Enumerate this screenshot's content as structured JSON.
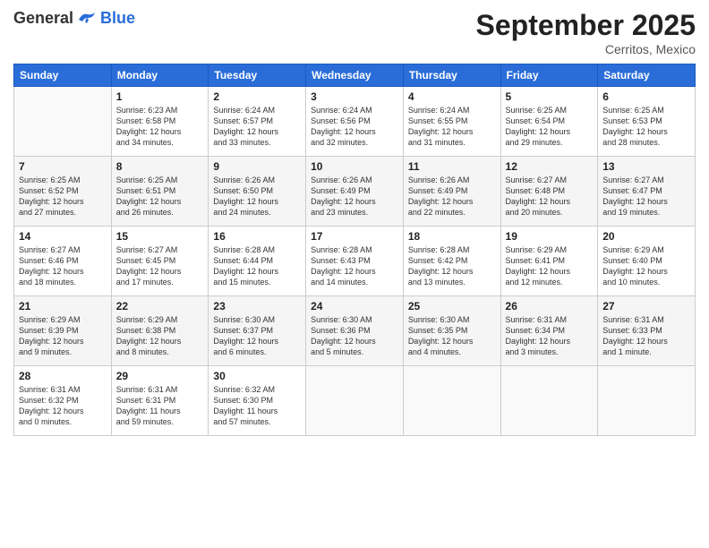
{
  "header": {
    "logo_general": "General",
    "logo_blue": "Blue",
    "month_year": "September 2025",
    "location": "Cerritos, Mexico"
  },
  "weekdays": [
    "Sunday",
    "Monday",
    "Tuesday",
    "Wednesday",
    "Thursday",
    "Friday",
    "Saturday"
  ],
  "weeks": [
    [
      {
        "day": "",
        "info": ""
      },
      {
        "day": "1",
        "info": "Sunrise: 6:23 AM\nSunset: 6:58 PM\nDaylight: 12 hours\nand 34 minutes."
      },
      {
        "day": "2",
        "info": "Sunrise: 6:24 AM\nSunset: 6:57 PM\nDaylight: 12 hours\nand 33 minutes."
      },
      {
        "day": "3",
        "info": "Sunrise: 6:24 AM\nSunset: 6:56 PM\nDaylight: 12 hours\nand 32 minutes."
      },
      {
        "day": "4",
        "info": "Sunrise: 6:24 AM\nSunset: 6:55 PM\nDaylight: 12 hours\nand 31 minutes."
      },
      {
        "day": "5",
        "info": "Sunrise: 6:25 AM\nSunset: 6:54 PM\nDaylight: 12 hours\nand 29 minutes."
      },
      {
        "day": "6",
        "info": "Sunrise: 6:25 AM\nSunset: 6:53 PM\nDaylight: 12 hours\nand 28 minutes."
      }
    ],
    [
      {
        "day": "7",
        "info": "Sunrise: 6:25 AM\nSunset: 6:52 PM\nDaylight: 12 hours\nand 27 minutes."
      },
      {
        "day": "8",
        "info": "Sunrise: 6:25 AM\nSunset: 6:51 PM\nDaylight: 12 hours\nand 26 minutes."
      },
      {
        "day": "9",
        "info": "Sunrise: 6:26 AM\nSunset: 6:50 PM\nDaylight: 12 hours\nand 24 minutes."
      },
      {
        "day": "10",
        "info": "Sunrise: 6:26 AM\nSunset: 6:49 PM\nDaylight: 12 hours\nand 23 minutes."
      },
      {
        "day": "11",
        "info": "Sunrise: 6:26 AM\nSunset: 6:49 PM\nDaylight: 12 hours\nand 22 minutes."
      },
      {
        "day": "12",
        "info": "Sunrise: 6:27 AM\nSunset: 6:48 PM\nDaylight: 12 hours\nand 20 minutes."
      },
      {
        "day": "13",
        "info": "Sunrise: 6:27 AM\nSunset: 6:47 PM\nDaylight: 12 hours\nand 19 minutes."
      }
    ],
    [
      {
        "day": "14",
        "info": "Sunrise: 6:27 AM\nSunset: 6:46 PM\nDaylight: 12 hours\nand 18 minutes."
      },
      {
        "day": "15",
        "info": "Sunrise: 6:27 AM\nSunset: 6:45 PM\nDaylight: 12 hours\nand 17 minutes."
      },
      {
        "day": "16",
        "info": "Sunrise: 6:28 AM\nSunset: 6:44 PM\nDaylight: 12 hours\nand 15 minutes."
      },
      {
        "day": "17",
        "info": "Sunrise: 6:28 AM\nSunset: 6:43 PM\nDaylight: 12 hours\nand 14 minutes."
      },
      {
        "day": "18",
        "info": "Sunrise: 6:28 AM\nSunset: 6:42 PM\nDaylight: 12 hours\nand 13 minutes."
      },
      {
        "day": "19",
        "info": "Sunrise: 6:29 AM\nSunset: 6:41 PM\nDaylight: 12 hours\nand 12 minutes."
      },
      {
        "day": "20",
        "info": "Sunrise: 6:29 AM\nSunset: 6:40 PM\nDaylight: 12 hours\nand 10 minutes."
      }
    ],
    [
      {
        "day": "21",
        "info": "Sunrise: 6:29 AM\nSunset: 6:39 PM\nDaylight: 12 hours\nand 9 minutes."
      },
      {
        "day": "22",
        "info": "Sunrise: 6:29 AM\nSunset: 6:38 PM\nDaylight: 12 hours\nand 8 minutes."
      },
      {
        "day": "23",
        "info": "Sunrise: 6:30 AM\nSunset: 6:37 PM\nDaylight: 12 hours\nand 6 minutes."
      },
      {
        "day": "24",
        "info": "Sunrise: 6:30 AM\nSunset: 6:36 PM\nDaylight: 12 hours\nand 5 minutes."
      },
      {
        "day": "25",
        "info": "Sunrise: 6:30 AM\nSunset: 6:35 PM\nDaylight: 12 hours\nand 4 minutes."
      },
      {
        "day": "26",
        "info": "Sunrise: 6:31 AM\nSunset: 6:34 PM\nDaylight: 12 hours\nand 3 minutes."
      },
      {
        "day": "27",
        "info": "Sunrise: 6:31 AM\nSunset: 6:33 PM\nDaylight: 12 hours\nand 1 minute."
      }
    ],
    [
      {
        "day": "28",
        "info": "Sunrise: 6:31 AM\nSunset: 6:32 PM\nDaylight: 12 hours\nand 0 minutes."
      },
      {
        "day": "29",
        "info": "Sunrise: 6:31 AM\nSunset: 6:31 PM\nDaylight: 11 hours\nand 59 minutes."
      },
      {
        "day": "30",
        "info": "Sunrise: 6:32 AM\nSunset: 6:30 PM\nDaylight: 11 hours\nand 57 minutes."
      },
      {
        "day": "",
        "info": ""
      },
      {
        "day": "",
        "info": ""
      },
      {
        "day": "",
        "info": ""
      },
      {
        "day": "",
        "info": ""
      }
    ]
  ]
}
